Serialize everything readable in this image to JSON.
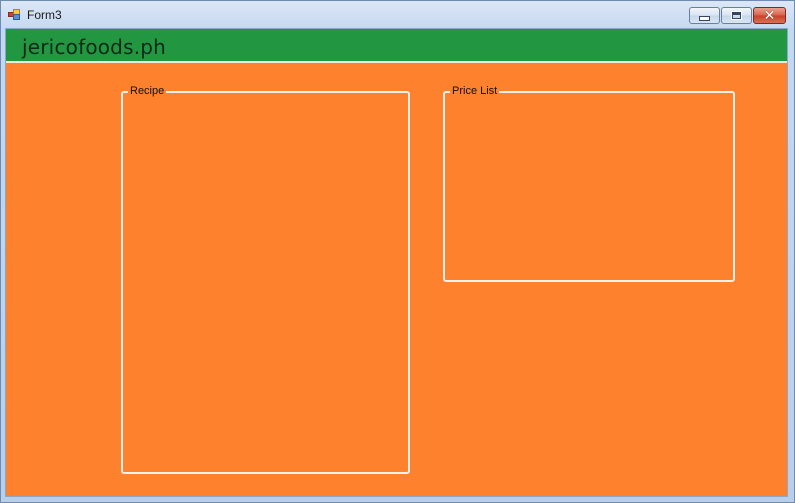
{
  "window": {
    "title": "Form3",
    "controls": {
      "minimize_icon": "minimize-icon",
      "maximize_icon": "maximize-icon",
      "close_glyph": "✕"
    }
  },
  "header": {
    "brand": "jericofoods.ph",
    "background": "#239642"
  },
  "form": {
    "background": "#fe812e",
    "groups": {
      "recipe": {
        "label": "Recipe"
      },
      "price_list": {
        "label": "Price List"
      }
    }
  }
}
